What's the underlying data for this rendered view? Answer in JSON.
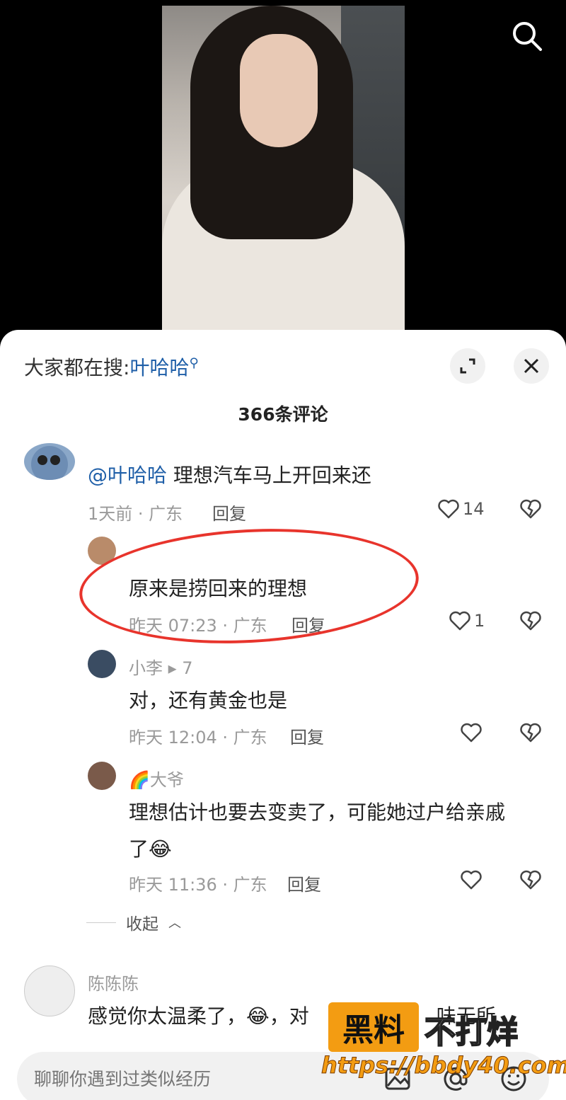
{
  "hot_search": {
    "prefix": "大家都在搜:",
    "keyword": "叶哈哈"
  },
  "comment_count": "366条评论",
  "comments": [
    {
      "name": "",
      "mention": "@叶哈哈",
      "text": "理想汽车马上开回来还",
      "time": "1天前 · 广东",
      "reply": "回复",
      "likes": "14"
    },
    {
      "name": "",
      "text": "原来是捞回来的理想",
      "time": "昨天 07:23 · 广东",
      "reply": "回复",
      "likes": "1"
    },
    {
      "name": "小李 ▸ 7",
      "text": "对，还有黄金也是",
      "time": "昨天 12:04 · 广东",
      "reply": "回复",
      "likes": ""
    },
    {
      "name": "🌈大爷",
      "text_line1": "理想估计也要去变卖了，可能她过户给亲戚",
      "text_line2": "了😂",
      "time": "昨天 11:36 · 广东",
      "reply": "回复",
      "likes": ""
    },
    {
      "name": "陈陈陈",
      "text": "感觉你太温柔了，😂，对",
      "suffix": "味无所"
    }
  ],
  "collapse_label": "收起",
  "input": {
    "placeholder": "聊聊你遇到过类似经历"
  },
  "watermark": {
    "box": "黑料",
    "rest": "不打烊",
    "url": "https://bbdy40.com"
  },
  "colors": {
    "accent": "#1f5fa8",
    "highlight": "#e8342c",
    "watermark": "#f39c12"
  }
}
